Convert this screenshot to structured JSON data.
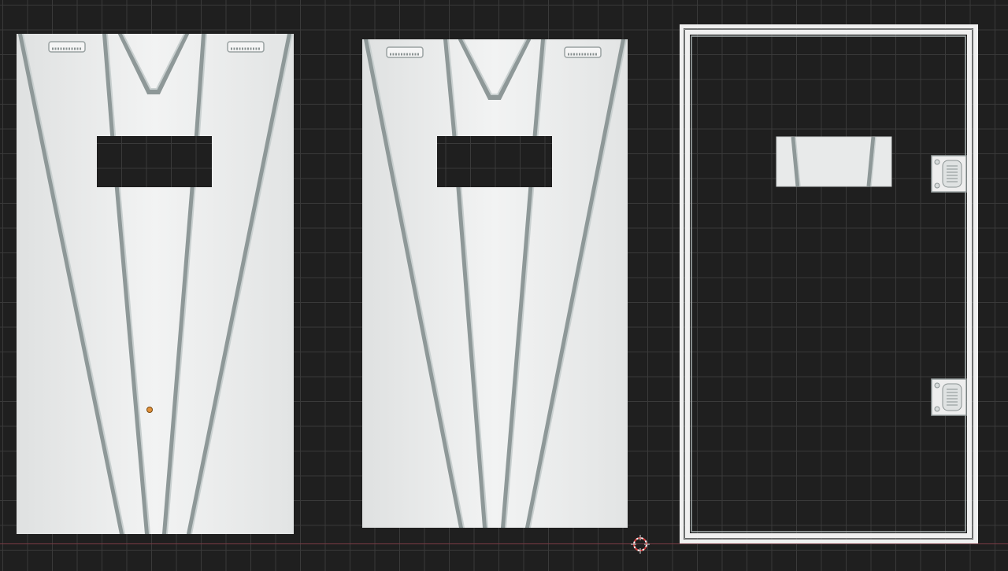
{
  "viewport": {
    "background": "#1f1f1f",
    "grid_color": "#3a3a3a",
    "x_axis_color": "#7a3b44",
    "cursor_icon": "3d-cursor-icon",
    "origin_icon": "object-origin-icon"
  },
  "panels": [
    {
      "name": "door-panel-left",
      "kind": "grooved-door",
      "color": "#e9eaea"
    },
    {
      "name": "door-panel-middle",
      "kind": "grooved-door",
      "color": "#e9eaea"
    },
    {
      "name": "door-frame-right",
      "kind": "frame-with-hinges",
      "color": "#ededed"
    }
  ],
  "colors": {
    "panel_fill": "#e9eaea",
    "groove_dark": "#8e9898",
    "groove_light": "#c9d0d0",
    "window_cutout": "#1f1f1f",
    "origin_dot": "#e0903a"
  }
}
